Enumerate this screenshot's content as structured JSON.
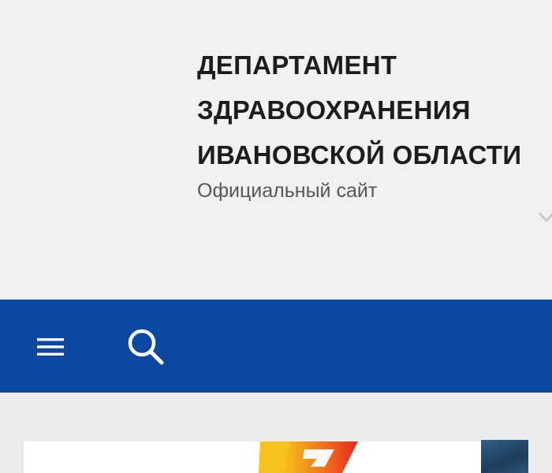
{
  "header": {
    "title_lines": [
      "ДЕПАРТАМЕНТ",
      "ЗДРАВООХРАНЕНИЯ",
      "ИВАНОВСКОЙ ОБЛАСТИ"
    ],
    "subtitle": "Официальный сайт"
  },
  "navbar": {
    "background": "#0a48a1",
    "menu_icon": "menu-icon",
    "search_icon": "search-icon"
  },
  "colors": {
    "page_background": "#f1f1f1",
    "nav_blue": "#0a48a1",
    "title_text": "#1d1d1d",
    "subtitle_text": "#565656"
  }
}
